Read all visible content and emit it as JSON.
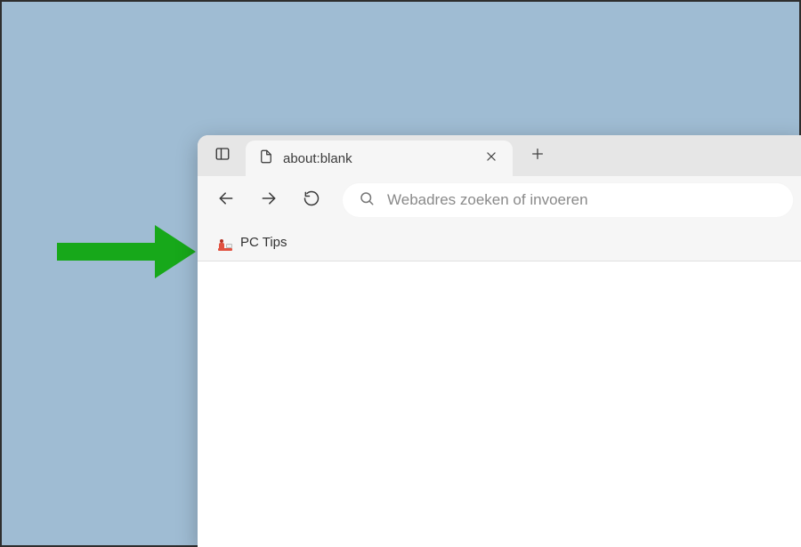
{
  "arrow": {
    "color": "#17a81a"
  },
  "tabstrip": {
    "tab_title": "about:blank"
  },
  "toolbar": {
    "address_placeholder": "Webadres zoeken of invoeren"
  },
  "bookmarks": {
    "items": [
      {
        "label": "PC Tips",
        "icon": "pctips-icon"
      }
    ]
  }
}
